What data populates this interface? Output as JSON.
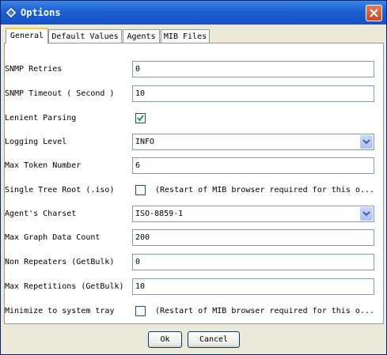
{
  "window": {
    "title": "Options"
  },
  "tabs": [
    {
      "label": "General",
      "active": true
    },
    {
      "label": "Default Values",
      "active": false
    },
    {
      "label": "Agents",
      "active": false
    },
    {
      "label": "MIB Files",
      "active": false
    }
  ],
  "form": {
    "snmp_retries": {
      "label": "SNMP Retries",
      "value": "0"
    },
    "snmp_timeout": {
      "label": "SNMP Timeout ( Second )",
      "value": "10"
    },
    "lenient_parsing": {
      "label": "Lenient Parsing",
      "checked": true
    },
    "logging_level": {
      "label": "Logging Level",
      "value": "INFO"
    },
    "max_token_number": {
      "label": "Max Token Number",
      "value": "6"
    },
    "single_tree_root": {
      "label": "Single Tree Root (.iso)",
      "checked": false,
      "note": "(Restart of MIB browser required for this o..."
    },
    "agents_charset": {
      "label": "Agent's Charset",
      "value": "ISO-8859-1"
    },
    "max_graph_data_count": {
      "label": "Max Graph Data Count",
      "value": "200"
    },
    "non_repeaters": {
      "label": "Non Repeaters (GetBulk)",
      "value": "0"
    },
    "max_repetitions": {
      "label": "Max Repetitions (GetBulk)",
      "value": "10"
    },
    "minimize_to_tray": {
      "label": "Minimize to system tray",
      "checked": false,
      "note": "(Restart of MIB browser required for this o..."
    }
  },
  "buttons": {
    "ok": "Ok",
    "cancel": "Cancel"
  },
  "colors": {
    "titlebar": "#1b5fd2",
    "check": "#21a121",
    "tab_highlight": "#ffc83c"
  }
}
